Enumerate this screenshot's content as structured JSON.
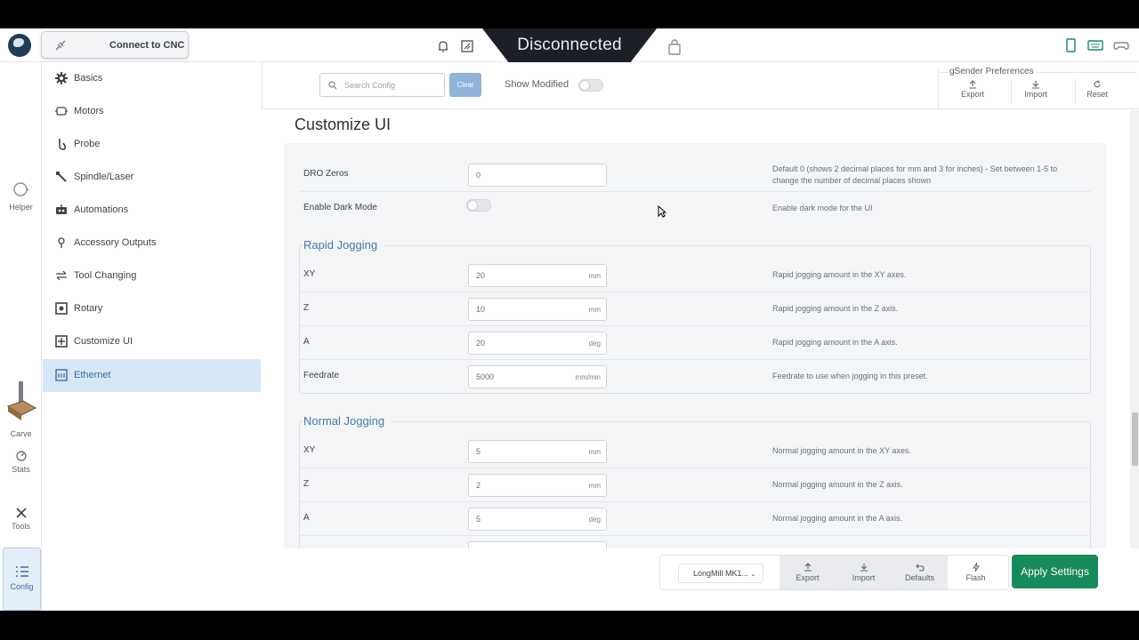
{
  "topbar": {
    "connect_label": "Connect to CNC",
    "status": "Disconnected",
    "icons": [
      "bell-icon",
      "settings-sheet-icon",
      "lock-icon",
      "phone-icon",
      "keyboard-icon",
      "gamepad-icon"
    ]
  },
  "leftnav": {
    "items": [
      {
        "label": "Helper",
        "icon": "helper-icon"
      },
      {
        "label": "Carve",
        "icon": "carve-icon"
      },
      {
        "label": "Stats",
        "icon": "stats-icon"
      },
      {
        "label": "Tools",
        "icon": "tools-icon"
      },
      {
        "label": "Config",
        "icon": "config-icon",
        "active": true
      }
    ]
  },
  "config_menu": {
    "items": [
      {
        "label": "Basics",
        "icon": "gear-icon"
      },
      {
        "label": "Motors",
        "icon": "motor-icon"
      },
      {
        "label": "Probe",
        "icon": "probe-icon"
      },
      {
        "label": "Spindle/Laser",
        "icon": "spindle-icon"
      },
      {
        "label": "Automations",
        "icon": "automation-icon"
      },
      {
        "label": "Accessory Outputs",
        "icon": "accessory-icon"
      },
      {
        "label": "Tool Changing",
        "icon": "tool-change-icon"
      },
      {
        "label": "Rotary",
        "icon": "rotary-icon"
      },
      {
        "label": "Customize UI",
        "icon": "customize-icon"
      },
      {
        "label": "Ethernet",
        "icon": "ethernet-icon",
        "active": true
      }
    ]
  },
  "settings_header": {
    "search_placeholder": "Search Config",
    "clear_label": "Clear",
    "show_modified_label": "Show Modified",
    "show_modified_on": false,
    "prefs_title": "gSender Preferences",
    "prefs_export": "Export",
    "prefs_import": "Import",
    "prefs_reset": "Reset"
  },
  "main": {
    "title": "Customize UI",
    "dro_zeros": {
      "label": "DRO Zeros",
      "value": "0",
      "desc": "Default 0 (shows 2 decimal places for mm and 3 for inches) - Set between 1-5 to change the number of decimal places shown"
    },
    "dark_mode": {
      "label": "Enable Dark Mode",
      "on": false,
      "desc": "Enable dark mode for the UI"
    },
    "rapid": {
      "title": "Rapid Jogging",
      "rows": [
        {
          "label": "XY",
          "value": "20",
          "unit": "mm",
          "desc": "Rapid jogging amount in the XY axes."
        },
        {
          "label": "Z",
          "value": "10",
          "unit": "mm",
          "desc": "Rapid jogging amount in the Z axis."
        },
        {
          "label": "A",
          "value": "20",
          "unit": "deg",
          "desc": "Rapid jogging amount in the A axis."
        },
        {
          "label": "Feedrate",
          "value": "5000",
          "unit": "mm/min",
          "desc": "Feedrate to use when jogging in this preset."
        }
      ]
    },
    "normal": {
      "title": "Normal Jogging",
      "rows": [
        {
          "label": "XY",
          "value": "5",
          "unit": "mm",
          "desc": "Normal jogging amount in the XY axes."
        },
        {
          "label": "Z",
          "value": "2",
          "unit": "mm",
          "desc": "Normal jogging amount in the Z axis."
        },
        {
          "label": "A",
          "value": "5",
          "unit": "deg",
          "desc": "Normal jogging amount in the A axis."
        }
      ]
    }
  },
  "bottombar": {
    "preset": "LongMill MK1...",
    "export": "Export",
    "import": "Import",
    "defaults": "Defaults",
    "flash": "Flash",
    "apply": "Apply Settings"
  },
  "colors": {
    "accent": "#3d6ea3",
    "apply": "#178a5b",
    "status_bg": "#1b2026"
  }
}
